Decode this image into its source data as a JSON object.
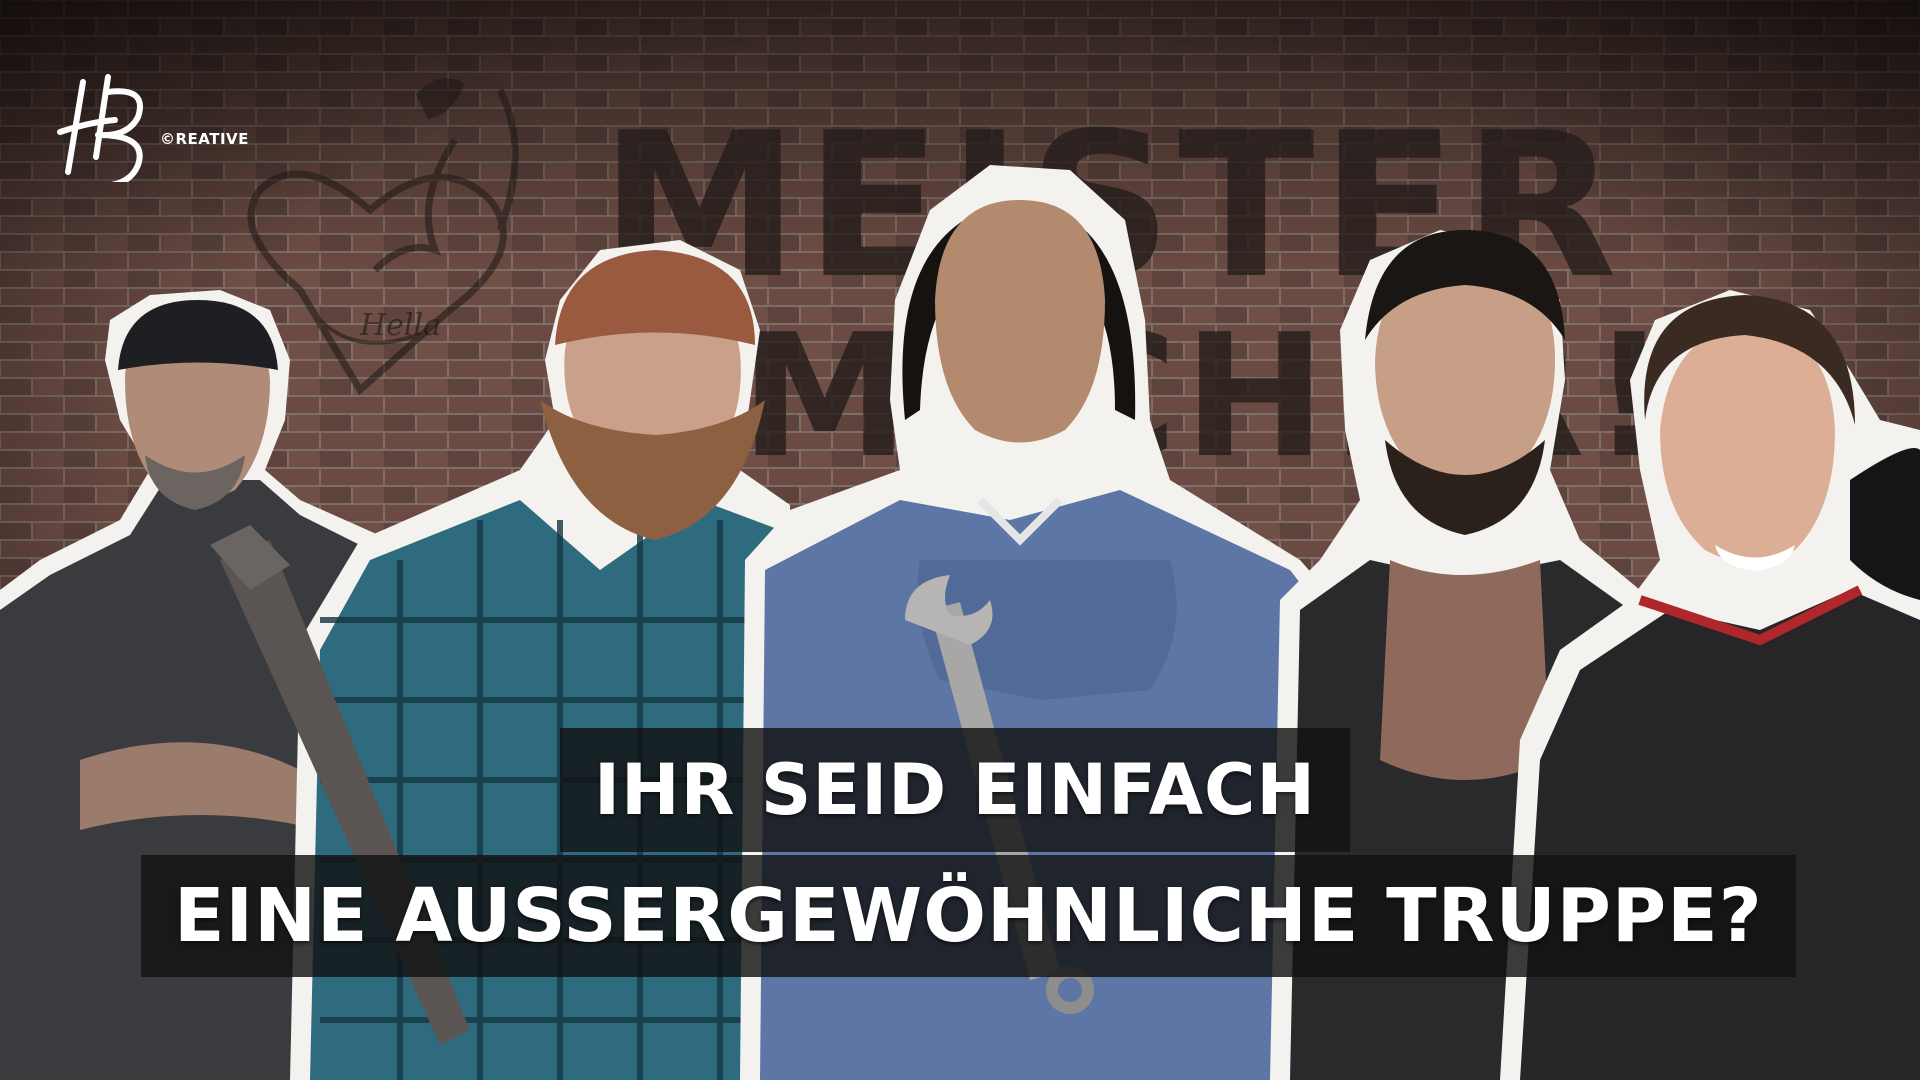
{
  "logo": {
    "script_text": "HB",
    "word": "©REATIVE"
  },
  "wall_graffiti": {
    "line1": "MEISTER",
    "line2": "MACHER!",
    "heart_label": "Hella"
  },
  "caption": {
    "line1": "IHR SEID EINFACH",
    "line2": "EINE AUSSERGEWÖHNLICHE TRUPPE?"
  },
  "colors": {
    "brick": "#6b4a42",
    "mortar": "#8e7f78",
    "caption_bg": "#121212",
    "caption_text": "#ffffff"
  }
}
